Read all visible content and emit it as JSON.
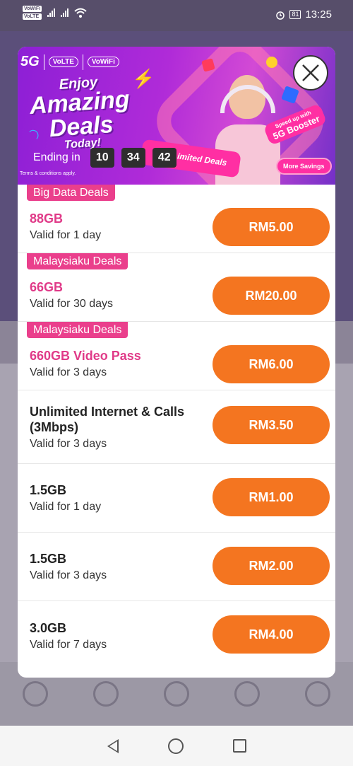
{
  "status_bar": {
    "wifi_tags": [
      "VoWiFi",
      "VoLTE"
    ],
    "battery": "81",
    "time": "13:25",
    "icons": [
      "signal-icon",
      "wifi-icon",
      "alarm-icon",
      "battery-icon"
    ]
  },
  "banner": {
    "brand_5g": "5G",
    "brand_volte": "VoLTE",
    "brand_vowifi": "VoWiFi",
    "headline_line1": "Enjoy",
    "headline_line2": "Amazing",
    "headline_line3": "Deals",
    "headline_line4": "Today!",
    "countdown_label": "Ending in",
    "countdown": {
      "hours": "10",
      "minutes": "34",
      "seconds": "42"
    },
    "terms": "Terms & conditions apply.",
    "promo_pill": "Day Limited Deals",
    "booster_sub": "Speed up with",
    "booster_main": "5G Booster",
    "more_savings": "More Savings"
  },
  "deals": [
    {
      "tag": "Big Data Deals",
      "title": "88GB",
      "validity": "Valid for 1 day",
      "price": "RM5.00",
      "highlight": true
    },
    {
      "tag": "Malaysiaku Deals",
      "title": "66GB",
      "validity": "Valid for 30 days",
      "price": "RM20.00",
      "highlight": true
    },
    {
      "tag": "Malaysiaku Deals",
      "title": "660GB Video Pass",
      "validity": "Valid for 3 days",
      "price": "RM6.00",
      "highlight": true
    },
    {
      "tag": "",
      "title": "Unlimited Internet & Calls (3Mbps)",
      "validity": "Valid for 3 days",
      "price": "RM3.50",
      "highlight": false
    },
    {
      "tag": "",
      "title": "1.5GB",
      "validity": "Valid for 1 day",
      "price": "RM1.00",
      "highlight": false
    },
    {
      "tag": "",
      "title": "1.5GB",
      "validity": "Valid for 3 days",
      "price": "RM2.00",
      "highlight": false
    },
    {
      "tag": "",
      "title": "3.0GB",
      "validity": "Valid for 7 days",
      "price": "RM4.00",
      "highlight": false
    }
  ],
  "colors": {
    "accent_orange": "#f47520",
    "tag_pink": "#ea3f8c",
    "title_pink": "#e03a88",
    "banner_purple": "#8d1fd6"
  }
}
